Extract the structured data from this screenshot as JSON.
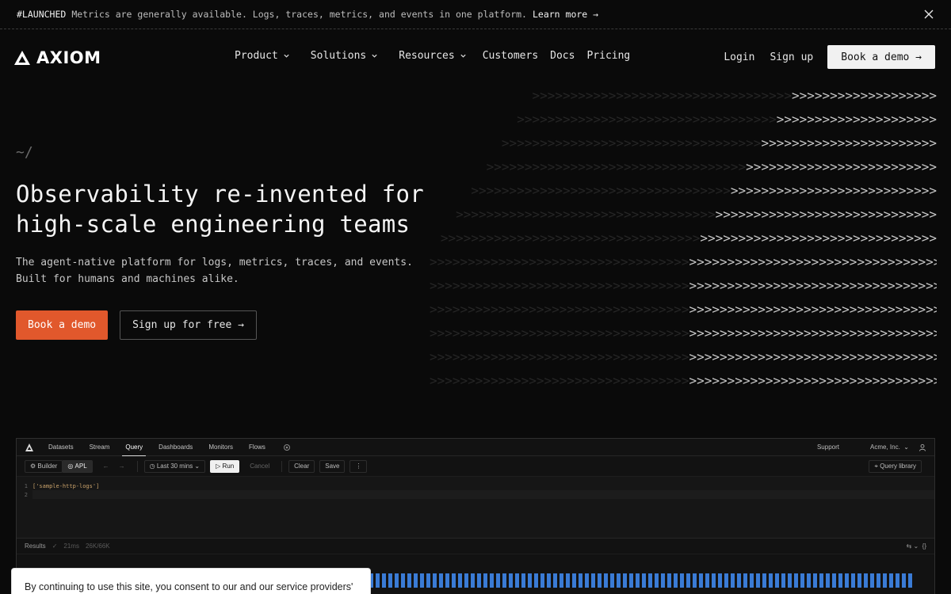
{
  "announcement": {
    "tag": "#LAUNCHED",
    "message": "Metrics are generally available. Logs, traces, metrics, and events in one platform.",
    "link": "Learn more →"
  },
  "brand": {
    "name": "AXIOM"
  },
  "nav": {
    "items": [
      {
        "label": "Product",
        "dropdown": true
      },
      {
        "label": "Solutions",
        "dropdown": true
      },
      {
        "label": "Resources",
        "dropdown": true
      },
      {
        "label": "Customers",
        "dropdown": false
      },
      {
        "label": "Docs",
        "dropdown": false
      },
      {
        "label": "Pricing",
        "dropdown": false
      }
    ],
    "login": "Login",
    "signup": "Sign up",
    "demo": "Book a demo →"
  },
  "hero": {
    "prompt": "~/",
    "headline_line1": "Observability re-invented for",
    "headline_line2": "high-scale engineering teams",
    "sub_line1": "The agent-native platform for logs, metrics, traces, and events.",
    "sub_line2": "Built for humans and machines alike.",
    "cta_primary": "Book a demo",
    "cta_secondary": "Sign up for free →"
  },
  "app": {
    "tabs": [
      "Datasets",
      "Stream",
      "Query",
      "Dashboards",
      "Monitors",
      "Flows"
    ],
    "active_tab": "Query",
    "support": "Support",
    "org": "Acme, Inc.",
    "toolbar": {
      "builder": "Builder",
      "apl": "APL",
      "time_range": "Last 30 mins",
      "run": "Run",
      "cancel": "Cancel",
      "clear": "Clear",
      "save": "Save",
      "query_library": "Query library"
    },
    "editor": {
      "lines": [
        {
          "num": "1",
          "code": "['sample-http-logs']"
        },
        {
          "num": "2",
          "code": ""
        }
      ]
    },
    "results": {
      "label": "Results",
      "time": "21ms",
      "rows": "26K/66K"
    }
  },
  "cookie": {
    "text": "By continuing to use this site, you consent to our and our service providers' use"
  },
  "colors": {
    "accent": "#e1582c",
    "background": "#0a0a0a",
    "chart_bar": "#3a7bd5"
  }
}
